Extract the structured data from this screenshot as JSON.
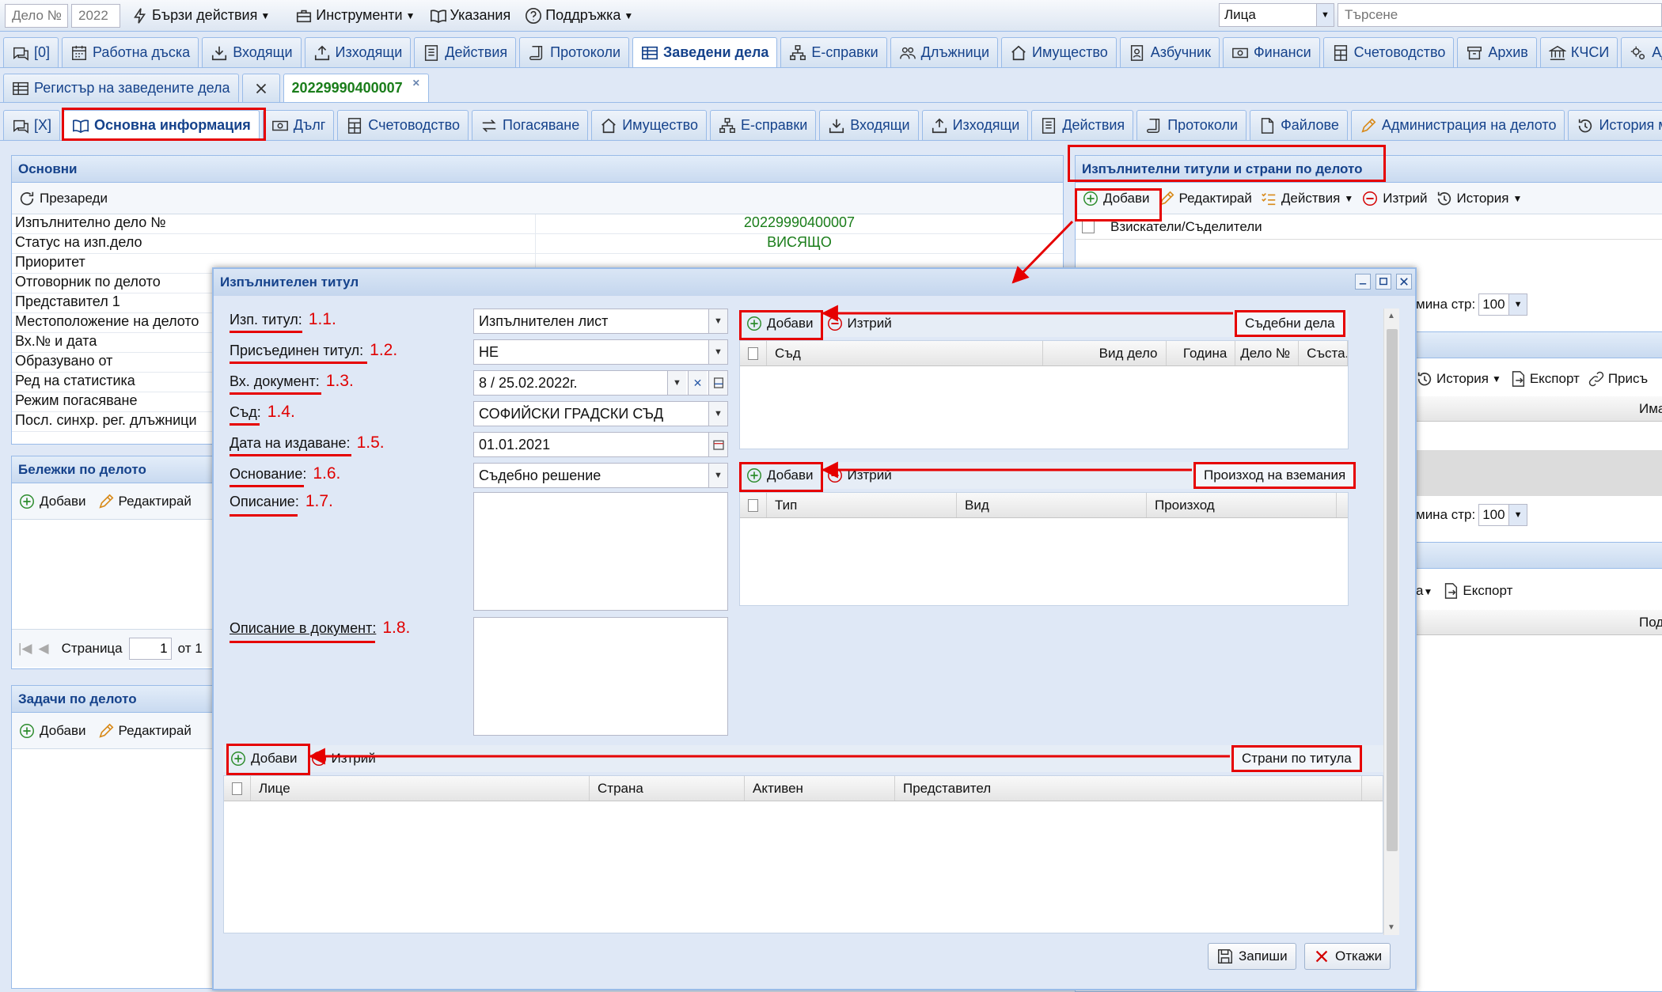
{
  "topbar": {
    "case_no_placeholder": "Дело №",
    "year_value": "2022",
    "quick_actions": "Бързи действия",
    "tools": "Инструменти",
    "guide": "Указания",
    "support": "Поддръжка",
    "person_type": "Лица",
    "search_placeholder": "Търсене"
  },
  "main_tabs": [
    "[0]",
    "Работна дъска",
    "Входящи",
    "Изходящи",
    "Действия",
    "Протоколи",
    "Заведени дела",
    "Е-справки",
    "Длъжници",
    "Имущество",
    "Азбучник",
    "Финанси",
    "Счетоводство",
    "Архив",
    "КЧСИ",
    "Адм"
  ],
  "doc_tabs": {
    "register": "Регистър на заведените дела",
    "case": "20229990400007"
  },
  "case_tabs": [
    "[X]",
    "Основна информация",
    "Дълг",
    "Счетоводство",
    "Погасяване",
    "Имущество",
    "Е-справки",
    "Входящи",
    "Изходящи",
    "Действия",
    "Протоколи",
    "Файлове",
    "Администрация на делото",
    "История местоп"
  ],
  "basic": {
    "title": "Основни",
    "reload": "Презареди",
    "rows": [
      {
        "k": "Изпълнително дело №",
        "v": "20229990400007"
      },
      {
        "k": "Статус на изп.дело",
        "v": "ВИСЯЩО"
      },
      {
        "k": "Приоритет",
        "v": ""
      },
      {
        "k": "Отговорник по делото",
        "v": ""
      },
      {
        "k": "Представител 1",
        "v": ""
      },
      {
        "k": "Местоположение на делото",
        "v": ""
      },
      {
        "k": "Вх.№ и дата",
        "v": ""
      },
      {
        "k": "Образувано от",
        "v": ""
      },
      {
        "k": "Ред на статистика",
        "v": ""
      },
      {
        "k": "Режим погасяване",
        "v": ""
      },
      {
        "k": "Посл. синхр. рег. длъжници",
        "v": ""
      }
    ]
  },
  "notes": {
    "title": "Бележки по делото",
    "add": "Добави",
    "edit": "Редактирай",
    "page_label": "Страница",
    "page_value": "1",
    "of": "от 1"
  },
  "tasks": {
    "title": "Задачи по делото",
    "add": "Добави",
    "edit": "Редактирай"
  },
  "titles": {
    "title": "Изпълнителни титули и страни по делото",
    "add": "Добави",
    "edit": "Редактирай",
    "actions": "Действия",
    "delete": "Изтрий",
    "history": "История",
    "col1": "Взискатели/Съделители",
    "per_page": "мина стр:",
    "per_page_value": "100",
    "history2": "История",
    "export": "Експорт",
    "attach": "Присъ",
    "col_name": "Има",
    "per_page2": "мина стр:",
    "per_page_value2": "100",
    "partial": "а",
    "export2": "Експорт",
    "col_sub": "Под"
  },
  "dialog": {
    "title": "Изпълнителен титул",
    "fields": [
      {
        "label": "Изп. титул:",
        "num": "1.1.",
        "value": "Изпълнителен лист",
        "kind": "combo"
      },
      {
        "label": "Присъединен титул:",
        "num": "1.2.",
        "value": "НЕ",
        "kind": "combo"
      },
      {
        "label": "Вх. документ:",
        "num": "1.3.",
        "value": "8 / 25.02.2022г.",
        "kind": "doc"
      },
      {
        "label": "Съд:",
        "num": "1.4.",
        "value": "СОФИЙСКИ ГРАДСКИ СЪД",
        "kind": "combo"
      },
      {
        "label": "Дата на издаване:",
        "num": "1.5.",
        "value": "01.01.2021",
        "kind": "date"
      },
      {
        "label": "Основание:",
        "num": "1.6.",
        "value": "Съдебно решение",
        "kind": "combo"
      }
    ],
    "description_label": "Описание:",
    "description_num": "1.7.",
    "doc_description_label": "Описание в документ:",
    "doc_description_num": "1.8.",
    "courts": {
      "add": "Добави",
      "delete": "Изтрий",
      "tag": "Съдебни дела",
      "cols": [
        "Съд",
        "Вид дело",
        "Година",
        "Дело №",
        "Съста..."
      ]
    },
    "origin": {
      "add": "Добави",
      "delete": "Изтрий",
      "tag": "Произход на вземания",
      "cols": [
        "Тип",
        "Вид",
        "Произход"
      ]
    },
    "parties": {
      "add": "Добави",
      "delete": "Изтрий",
      "tag": "Страни по титула",
      "cols": [
        "Лице",
        "Страна",
        "Активен",
        "Представител"
      ]
    },
    "save": "Запиши",
    "cancel": "Откажи"
  },
  "colors": {
    "accent_red": "#e60000",
    "header_blue": "#15428b",
    "value_green": "#1a7d1a"
  }
}
